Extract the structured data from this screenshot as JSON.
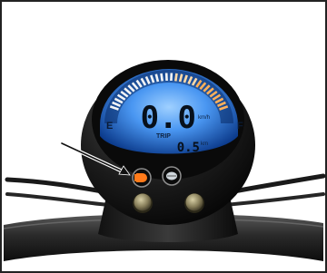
{
  "meter": {
    "empty_label": "E",
    "full_label": "F",
    "speed": "0.0",
    "speed_unit": "km/h",
    "trip_label": "TRIP",
    "trip_value": "0.5",
    "trip_unit": "km",
    "battery_level": 1.0
  },
  "indicators": {
    "left": {
      "icon": "headlight-icon",
      "color": "#ff7a1a"
    },
    "right": {
      "icon": "horn-icon",
      "color": "#cfd6dc"
    }
  },
  "buttons": [
    {
      "name": "left-control-button"
    },
    {
      "name": "right-control-button"
    }
  ],
  "colors": {
    "lcd_blue": "#3e8df0",
    "lcd_dark": "#08131f",
    "bezel": "#1a1a1a",
    "indicator_orange": "#ff7a1a"
  }
}
